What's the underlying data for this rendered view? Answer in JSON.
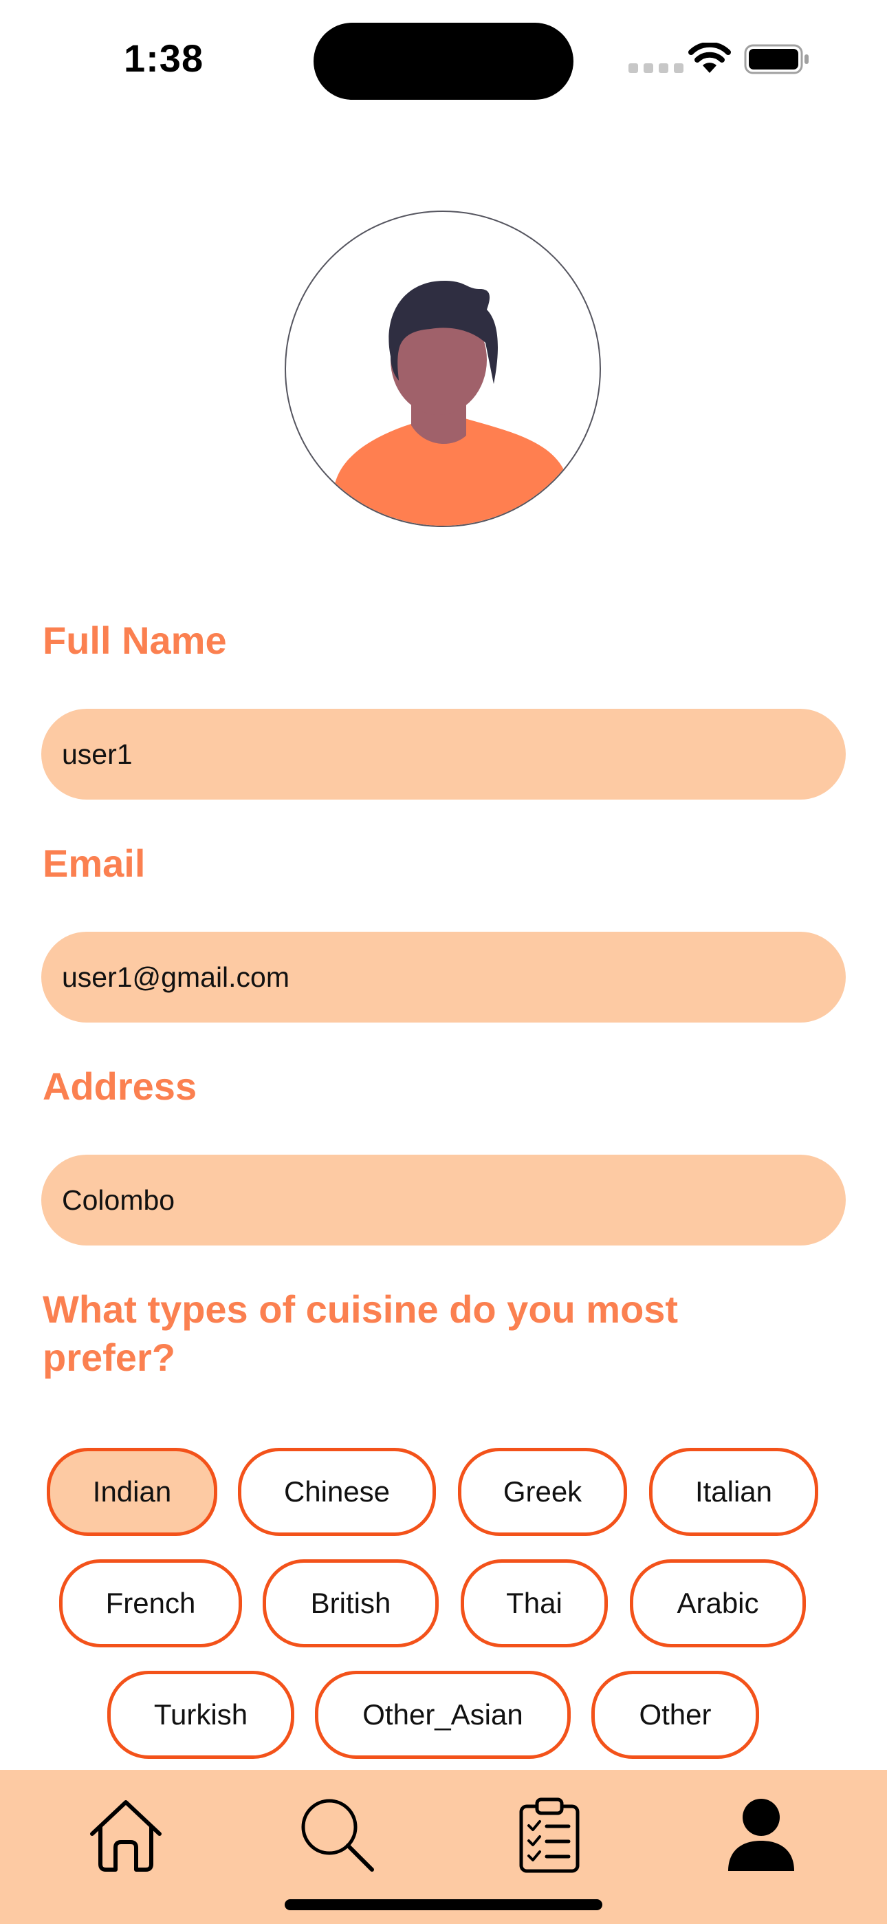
{
  "status_bar": {
    "time": "1:38"
  },
  "profile": {
    "avatar_icon": "person-avatar-illustration"
  },
  "form": {
    "full_name": {
      "label": "Full Name",
      "value": "user1"
    },
    "email": {
      "label": "Email",
      "value": "user1@gmail.com"
    },
    "address": {
      "label": "Address",
      "value": "Colombo"
    }
  },
  "cuisine": {
    "question": "What types of cuisine do you most prefer?",
    "options": [
      {
        "label": "Indian",
        "selected": true
      },
      {
        "label": "Chinese",
        "selected": false
      },
      {
        "label": "Greek",
        "selected": false
      },
      {
        "label": "Italian",
        "selected": false
      },
      {
        "label": "French",
        "selected": false
      },
      {
        "label": "British",
        "selected": false
      },
      {
        "label": "Thai",
        "selected": false
      },
      {
        "label": "Arabic",
        "selected": false
      },
      {
        "label": "Turkish",
        "selected": false
      },
      {
        "label": "Other_Asian",
        "selected": false
      },
      {
        "label": "Other",
        "selected": false
      }
    ]
  },
  "tab_bar": {
    "tabs": [
      {
        "icon": "home-icon"
      },
      {
        "icon": "search-icon"
      },
      {
        "icon": "clipboard-checklist-icon"
      },
      {
        "icon": "profile-icon",
        "active": true
      }
    ]
  },
  "colors": {
    "accent": "#fb8050",
    "input_bg": "#fdcaa3",
    "chip_border": "#f3521a",
    "tab_bar_bg": "#fdcaa3"
  }
}
